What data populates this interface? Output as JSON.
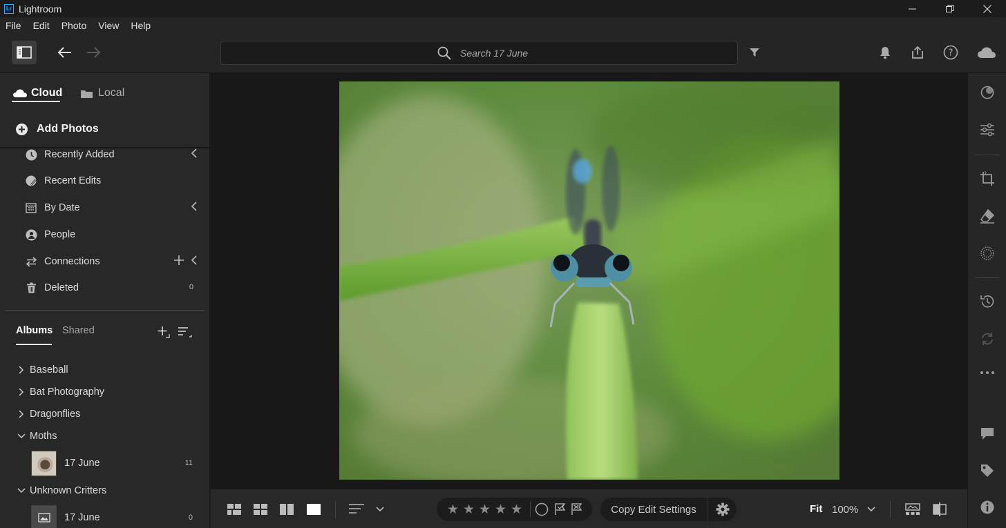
{
  "app": {
    "logo_text": "Lr",
    "title": "Lightroom"
  },
  "menu": [
    "File",
    "Edit",
    "Photo",
    "View",
    "Help"
  ],
  "search": {
    "placeholder": "Search 17 June"
  },
  "sidebar": {
    "tabs": [
      {
        "label": "Cloud",
        "active": true
      },
      {
        "label": "Local",
        "active": false
      }
    ],
    "add_photos_label": "Add Photos",
    "nav_items": [
      {
        "label": "Recently Added",
        "icon": "clock-icon"
      },
      {
        "label": "Recent Edits",
        "icon": "recent-edits-icon"
      },
      {
        "label": "By Date",
        "icon": "calendar-icon"
      },
      {
        "label": "People",
        "icon": "person-icon"
      },
      {
        "label": "Connections",
        "icon": "connections-icon"
      },
      {
        "label": "Deleted",
        "icon": "trash-icon",
        "count": "0"
      }
    ],
    "album_tabs": [
      {
        "label": "Albums",
        "active": true
      },
      {
        "label": "Shared",
        "active": false
      }
    ],
    "albums": [
      {
        "label": "Baseball",
        "expanded": false
      },
      {
        "label": "Bat Photography",
        "expanded": false
      },
      {
        "label": "Dragonflies",
        "expanded": false
      },
      {
        "label": "Moths",
        "expanded": true,
        "children": [
          {
            "label": "17 June",
            "count": "11"
          }
        ]
      },
      {
        "label": "Unknown Critters",
        "expanded": true,
        "children": [
          {
            "label": "17 June",
            "count": "0"
          }
        ]
      }
    ]
  },
  "bottombar": {
    "copy_edit_label": "Copy Edit Settings",
    "fit_label": "Fit",
    "zoom_value": "100%",
    "star_glyph": "★"
  },
  "colors": {
    "accent": "#31a8ff",
    "background": "#1e1e1e",
    "panel": "#282828"
  }
}
